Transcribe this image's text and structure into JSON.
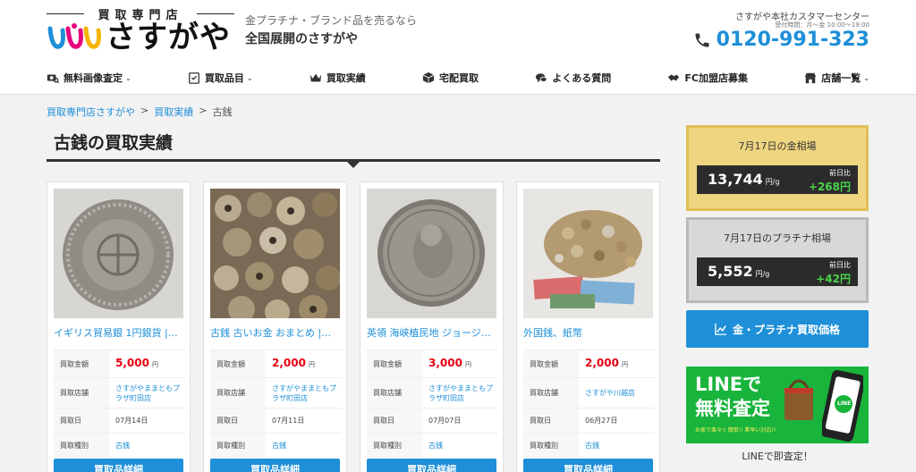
{
  "header": {
    "logo_top": "買取専門店",
    "logo_text": "さすがや",
    "tagline1": "金プラチナ・ブランド品を売るなら",
    "tagline2": "全国展開のさすがや",
    "cc_title": "さすがや本社カスタマーセンター",
    "cc_hours": "受付時間：月～金 10:00～19:00",
    "phone": "0120-991-323"
  },
  "nav": {
    "items": [
      {
        "label": "無料画像査定",
        "icon": "camera-search-icon",
        "dropdown": true
      },
      {
        "label": "買取品目",
        "icon": "checklist-icon",
        "dropdown": true
      },
      {
        "label": "買取実績",
        "icon": "crown-icon",
        "dropdown": false
      },
      {
        "label": "宅配買取",
        "icon": "box-icon",
        "dropdown": false
      },
      {
        "label": "よくある質問",
        "icon": "chat-icon",
        "dropdown": false
      },
      {
        "label": "FC加盟店募集",
        "icon": "handshake-icon",
        "dropdown": false
      },
      {
        "label": "店舗一覧",
        "icon": "store-icon",
        "dropdown": true
      }
    ],
    "caret": "⌄"
  },
  "breadcrumb": {
    "items": [
      "買取専門店さすがや",
      "買取実績",
      "古銭"
    ],
    "separator": ">"
  },
  "page": {
    "title": "古銭の買取実績"
  },
  "cards": {
    "labels": {
      "amount": "買取金額",
      "store": "買取店舗",
      "date": "買取日",
      "type": "買取種別",
      "unit": "円",
      "button": "買取品詳細"
    },
    "items": [
      {
        "title": "イギリス貿易銀 1円銀貨 |…",
        "price": "5,000",
        "store": "さすがやままともプラザ町田店",
        "date": "07月14日",
        "type": "古銭"
      },
      {
        "title": "古銭 古いお金 おまとめ |…",
        "price": "2,000",
        "store": "さすがやままともプラザ町田店",
        "date": "07月11日",
        "type": "古銭"
      },
      {
        "title": "英領 海峡植民地 ジョージ…",
        "price": "3,000",
        "store": "さすがやままともプラザ町田店",
        "date": "07月07日",
        "type": "古銭"
      },
      {
        "title": "外国銭、紙幣",
        "price": "2,000",
        "store": "さすがや川越店",
        "date": "06月27日",
        "type": "古銭"
      }
    ]
  },
  "sidebar": {
    "gold": {
      "title": "7月17日の金相場",
      "value": "13,744",
      "unit": "円/g",
      "diff_label": "前日比",
      "diff": "+268円"
    },
    "platinum": {
      "title": "7月17日のプラチナ相場",
      "value": "5,552",
      "unit": "円/g",
      "diff_label": "前日比",
      "diff": "+42円"
    },
    "price_button": "金・プラチナ買取価格",
    "line_banner": {
      "line1": "LINEで",
      "line2": "無料査定",
      "sub": "お家で楽々!! 簡単!! 素早い対応!!",
      "badge": "LINE"
    },
    "line_caption": "LINEで即査定！"
  },
  "colors": {
    "accent": "#1e8fd8",
    "price": "#e60012",
    "gold": "#f0d580",
    "platinum": "#d8d8d8",
    "line": "#18b43c"
  }
}
